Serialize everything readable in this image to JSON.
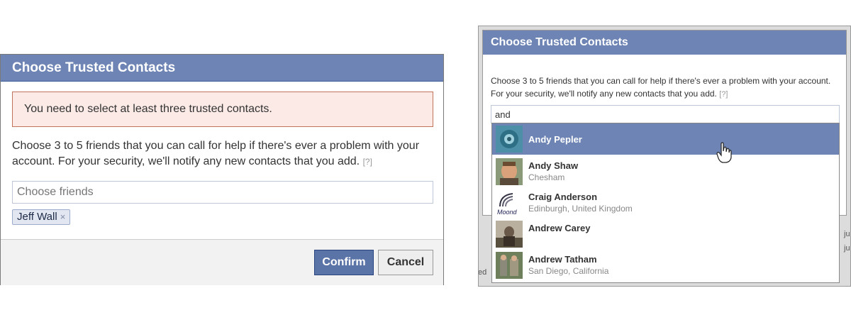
{
  "left_dialog": {
    "title": "Choose Trusted Contacts",
    "error": "You need to select at least three trusted contacts.",
    "description": "Choose 3 to 5 friends that you can call for help if there's ever a problem with your account. For your security, we'll notify any new contacts that you add.",
    "help": "[?]",
    "input_placeholder": "Choose friends",
    "selected_token": "Jeff Wall",
    "token_remove": "×",
    "confirm_label": "Confirm",
    "cancel_label": "Cancel"
  },
  "right_dialog": {
    "title": "Choose Trusted Contacts",
    "description": "Choose 3 to 5 friends that you can call for help if there's ever a problem with your account. For your security, we'll notify any new contacts that you add.",
    "help": "[?]",
    "search_value": "and",
    "background_text": [
      "ed",
      "ju",
      "ju"
    ],
    "suggestions": [
      {
        "name": "Andy Pepler",
        "location": "",
        "selected": true
      },
      {
        "name": "Andy Shaw",
        "location": "Chesham",
        "selected": false
      },
      {
        "name": "Craig Anderson",
        "location": "Edinburgh, United Kingdom",
        "selected": false,
        "avatar_text": "Moond"
      },
      {
        "name": "Andrew Carey",
        "location": "",
        "selected": false
      },
      {
        "name": "Andrew Tatham",
        "location": "San Diego, California",
        "selected": false
      }
    ]
  },
  "colors": {
    "header_blue": "#6d84b4",
    "error_bg": "#fbeae6",
    "error_border": "#c0735a"
  }
}
